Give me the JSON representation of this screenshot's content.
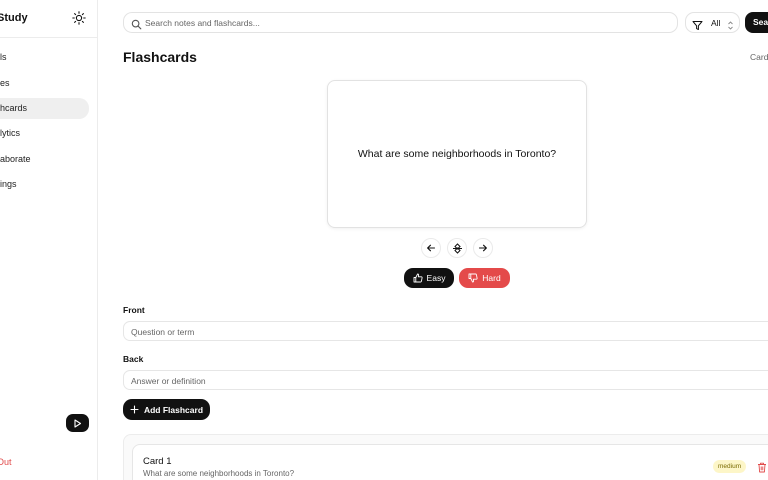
{
  "sidebar": {
    "brand": "Study",
    "items": [
      {
        "label": "Tools",
        "visible": "ls"
      },
      {
        "label": "Notes",
        "visible": "es"
      },
      {
        "label": "Flashcards",
        "visible": "hcards"
      },
      {
        "label": "Analytics",
        "visible": "lytics"
      },
      {
        "label": "Collaborate",
        "visible": "aborate"
      },
      {
        "label": "Settings",
        "visible": "ings"
      }
    ],
    "active_index": 2,
    "signout": "Out"
  },
  "topbar": {
    "search_placeholder": "Search notes and flashcards...",
    "filter_value": "All",
    "search_button": "Sea"
  },
  "main": {
    "title": "Flashcards",
    "counter": "Card",
    "flashcard_question": "What are some neighborhoods in Toronto?",
    "easy_label": "Easy",
    "hard_label": "Hard",
    "front_label": "Front",
    "front_placeholder": "Question or term",
    "back_label": "Back",
    "back_placeholder": "Answer or definition",
    "add_label": "Add Flashcard"
  },
  "cards": [
    {
      "title": "Card 1",
      "text": "What are some neighborhoods in Toronto?",
      "difficulty": "medium"
    }
  ],
  "colors": {
    "accent": "#111111",
    "danger": "#e44a4a",
    "badge_bg": "#fdf6c8"
  }
}
